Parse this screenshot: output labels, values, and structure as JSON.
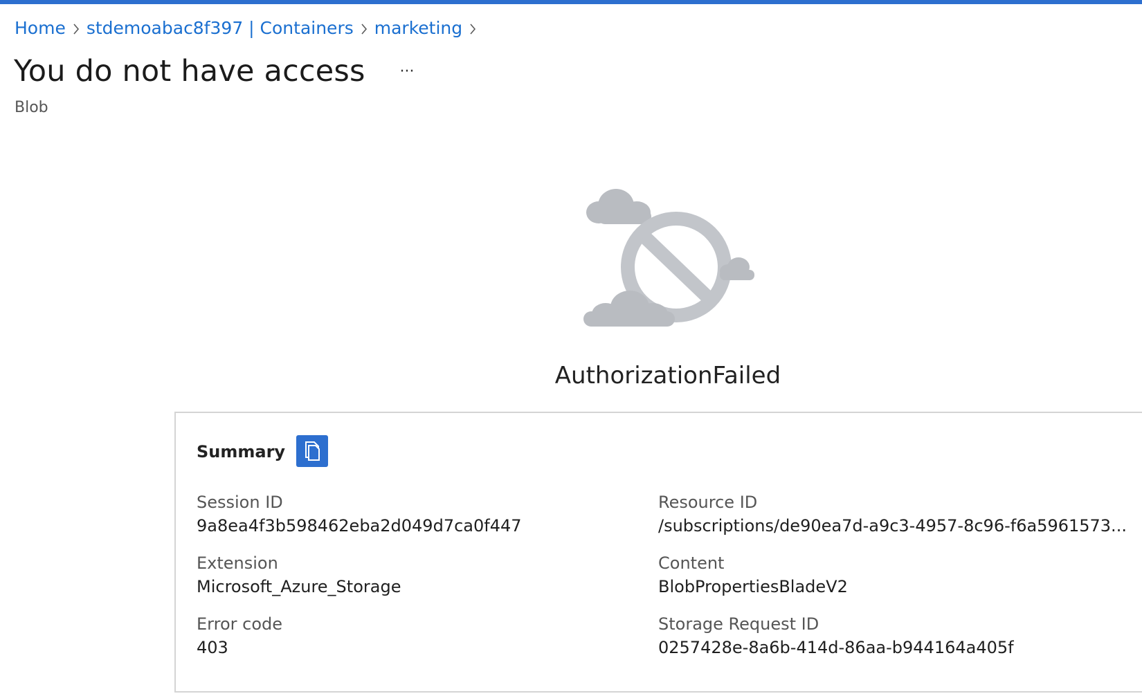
{
  "breadcrumb": {
    "items": [
      {
        "label": "Home"
      },
      {
        "label": "stdemoabac8f397 | Containers"
      },
      {
        "label": "marketing"
      }
    ]
  },
  "header": {
    "title": "You do not have access",
    "more_label": "···",
    "subtitle": "Blob"
  },
  "error": {
    "title": "AuthorizationFailed",
    "icon": "no-access-cloud-icon"
  },
  "summary": {
    "heading": "Summary",
    "copy_icon": "copy-icon",
    "fields": {
      "session_id": {
        "label": "Session ID",
        "value": "9a8ea4f3b598462eba2d049d7ca0f447"
      },
      "resource_id": {
        "label": "Resource ID",
        "value": "/subscriptions/de90ea7d-a9c3-4957-8c96-f6a5961573..."
      },
      "extension": {
        "label": "Extension",
        "value": "Microsoft_Azure_Storage"
      },
      "content": {
        "label": "Content",
        "value": "BlobPropertiesBladeV2"
      },
      "error_code": {
        "label": "Error code",
        "value": "403"
      },
      "storage_request_id": {
        "label": "Storage Request ID",
        "value": "0257428e-8a6b-414d-86aa-b944164a405f"
      }
    }
  },
  "colors": {
    "accent": "#2d6fcf",
    "link": "#1a6fd0",
    "illustration": "#b9bcc1"
  }
}
